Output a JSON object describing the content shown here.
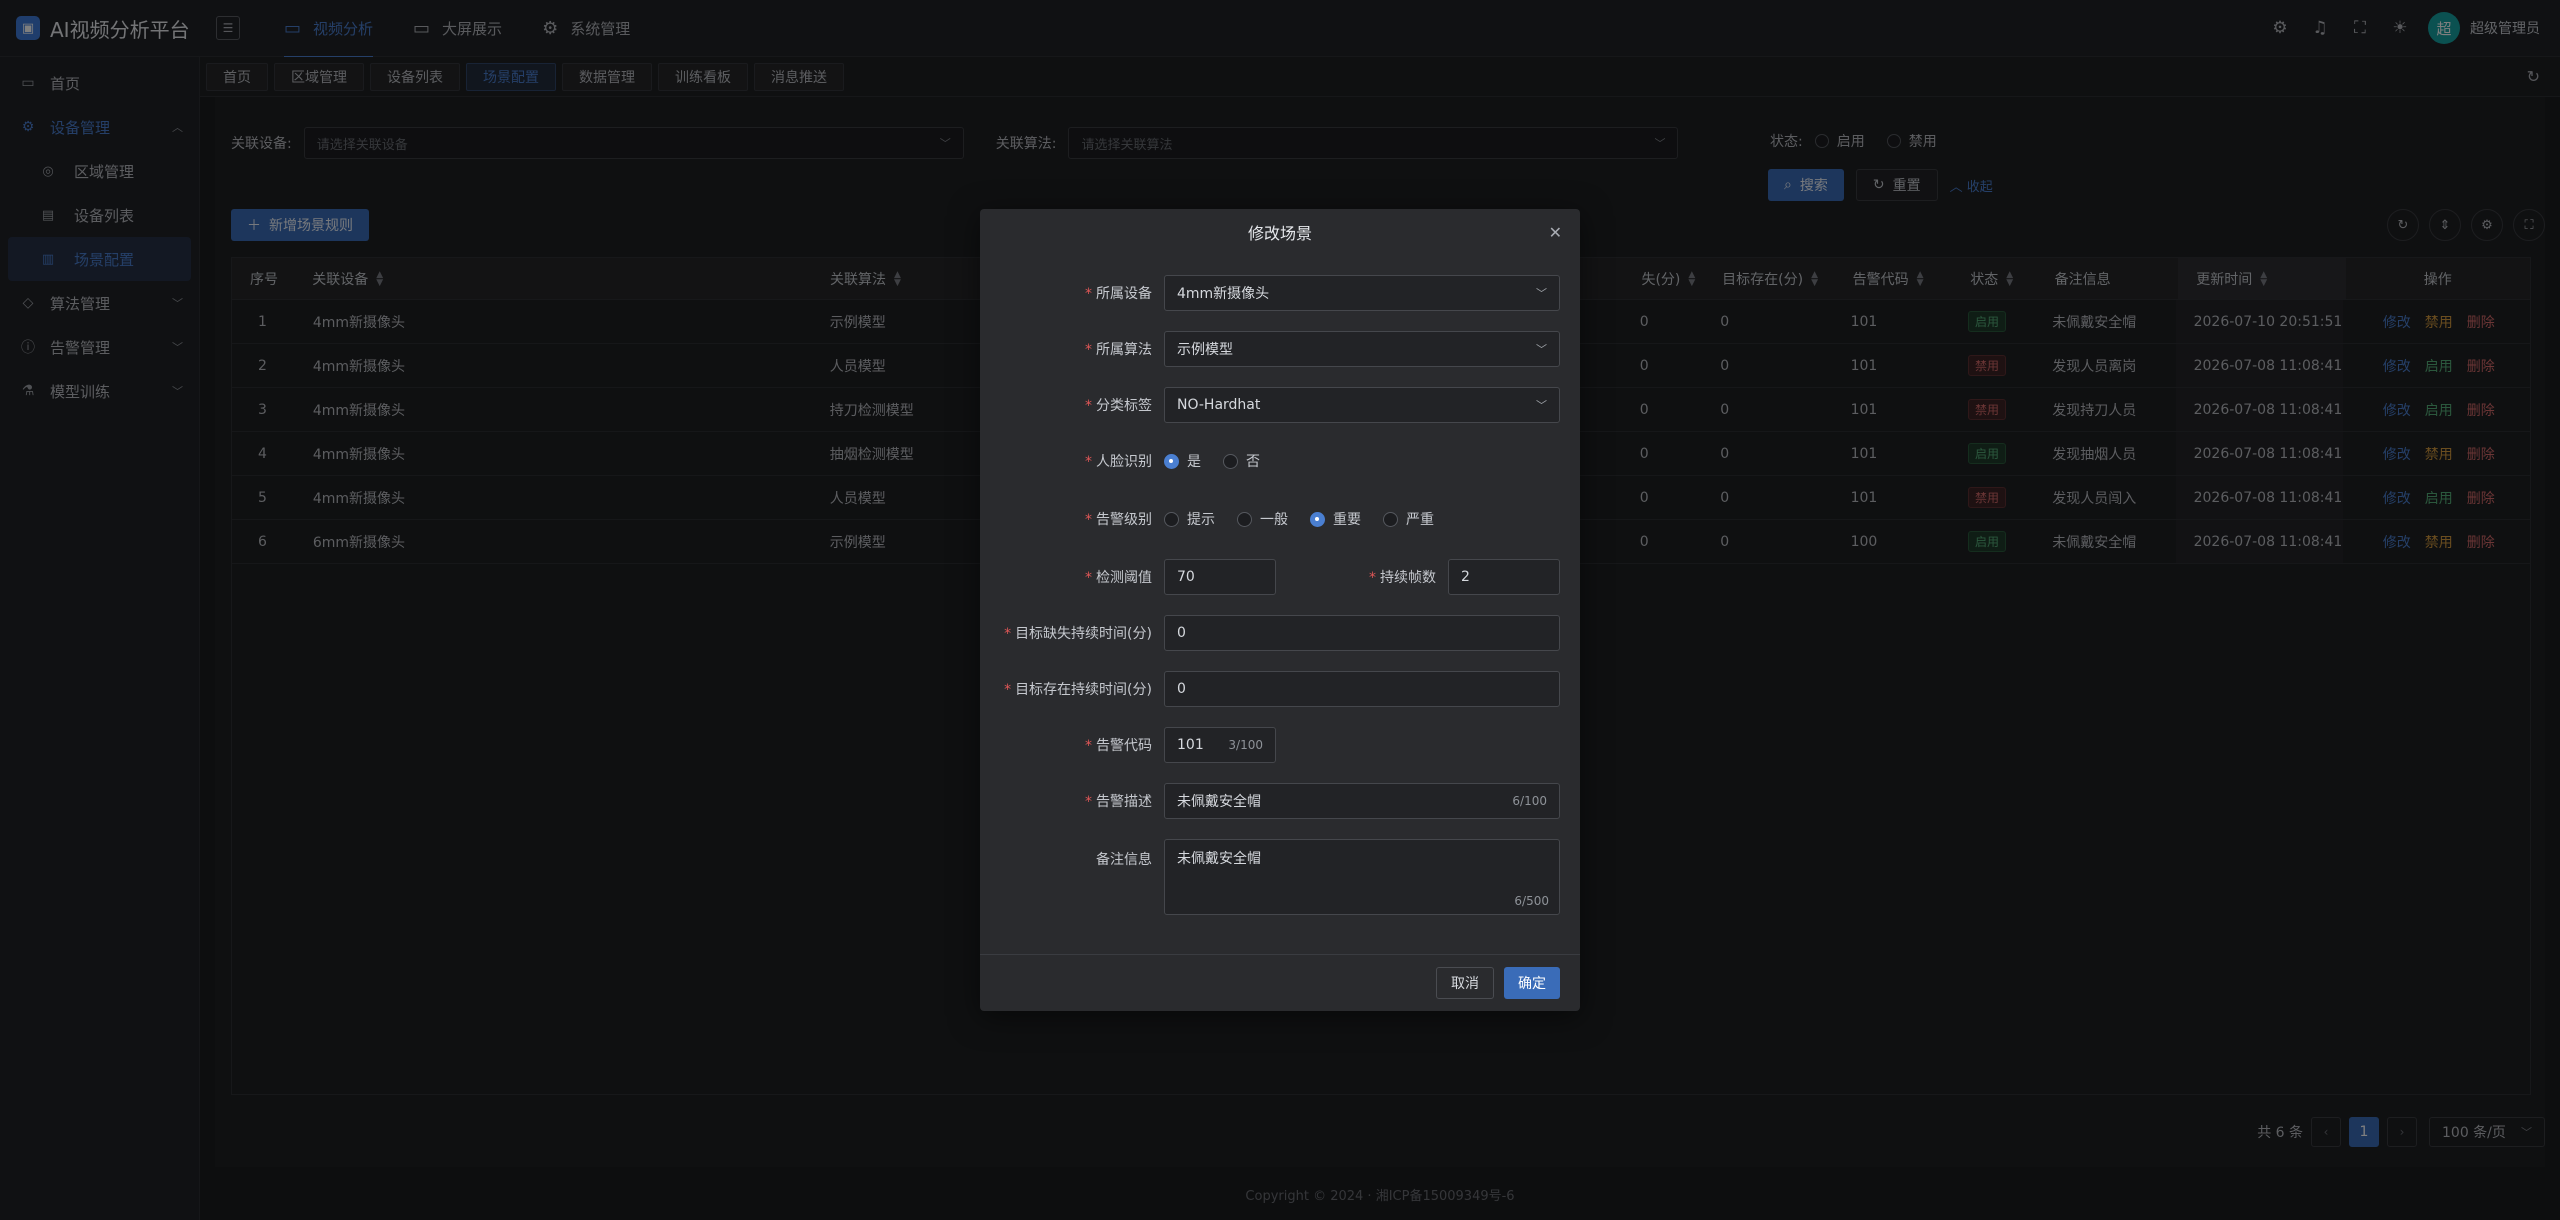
{
  "app": {
    "title": "AI视频分析平台",
    "logo_char": "▣"
  },
  "topnav": [
    {
      "label": "视频分析",
      "icon": "video-camera-icon",
      "glyph": "▭"
    },
    {
      "label": "大屏展示",
      "icon": "monitor-icon",
      "glyph": "▭"
    },
    {
      "label": "系统管理",
      "icon": "gear-icon",
      "glyph": "⚙"
    }
  ],
  "header_icons": [
    "settings-icon",
    "bell-icon",
    "fullscreen-icon",
    "theme-icon"
  ],
  "user": {
    "avatar_char": "超",
    "name": "超级管理员",
    "chevron": "⌄"
  },
  "sidebar": {
    "home": "首页",
    "device_mgmt": "设备管理",
    "sub": [
      "区域管理",
      "设备列表",
      "场景配置"
    ],
    "algo_mgmt": "算法管理",
    "alarm_mgmt": "告警管理",
    "model_train": "模型训练"
  },
  "tabs": [
    "首页",
    "区域管理",
    "设备列表",
    "场景配置",
    "数据管理",
    "训练看板",
    "消息推送"
  ],
  "filter": {
    "device_label": "关联设备:",
    "device_placeholder": "请选择关联设备",
    "algo_label": "关联算法:",
    "algo_placeholder": "请选择关联算法",
    "status_label": "状态:",
    "status_opts": [
      "启用",
      "禁用"
    ],
    "search_btn": "搜索",
    "reset_btn": "重置",
    "collapse_link": "收起"
  },
  "add_btn": "新增场景规则",
  "table": {
    "headers": [
      "序号",
      "关联设备",
      "关联算法",
      "失(分)",
      "目标存在(分)",
      "告警代码",
      "状态",
      "备注信息",
      "更新时间",
      "操作"
    ],
    "rows": [
      {
        "no": "1",
        "device": "4mm新摄像头",
        "algo": "示例模型",
        "lost": "0",
        "exist": "0",
        "code": "101",
        "status": "启用",
        "note": "未佩戴安全帽",
        "time": "2026-07-10 20:51:51",
        "ops": [
          "修改",
          "禁用",
          "删除"
        ]
      },
      {
        "no": "2",
        "device": "4mm新摄像头",
        "algo": "人员模型",
        "lost": "0",
        "exist": "0",
        "code": "101",
        "status": "禁用",
        "note": "发现人员离岗",
        "time": "2026-07-08 11:08:41",
        "ops": [
          "修改",
          "启用",
          "删除"
        ]
      },
      {
        "no": "3",
        "device": "4mm新摄像头",
        "algo": "持刀检测模型",
        "lost": "0",
        "exist": "0",
        "code": "101",
        "status": "禁用",
        "note": "发现持刀人员",
        "time": "2026-07-08 11:08:41",
        "ops": [
          "修改",
          "启用",
          "删除"
        ]
      },
      {
        "no": "4",
        "device": "4mm新摄像头",
        "algo": "抽烟检测模型",
        "lost": "0",
        "exist": "0",
        "code": "101",
        "status": "启用",
        "note": "发现抽烟人员",
        "time": "2026-07-08 11:08:41",
        "ops": [
          "修改",
          "禁用",
          "删除"
        ]
      },
      {
        "no": "5",
        "device": "4mm新摄像头",
        "algo": "人员模型",
        "lost": "0",
        "exist": "0",
        "code": "101",
        "status": "禁用",
        "note": "发现人员闯入",
        "time": "2026-07-08 11:08:41",
        "ops": [
          "修改",
          "启用",
          "删除"
        ]
      },
      {
        "no": "6",
        "device": "6mm新摄像头",
        "algo": "示例模型",
        "lost": "0",
        "exist": "0",
        "code": "100",
        "status": "启用",
        "note": "未佩戴安全帽",
        "time": "2026-07-08 11:08:41",
        "ops": [
          "修改",
          "禁用",
          "删除"
        ]
      }
    ]
  },
  "pager": {
    "total": "共 6 条",
    "current": "1",
    "size": "100 条/页"
  },
  "footer": "Copyright © 2024 · 湘ICP备15009349号-6",
  "dialog": {
    "title": "修改场景",
    "device_label": "所属设备",
    "device_value": "4mm新摄像头",
    "algo_label": "所属算法",
    "algo_value": "示例模型",
    "tag_label": "分类标签",
    "tag_value": "NO-Hardhat",
    "face_label": "人脸识别",
    "face_opts": [
      "是",
      "否"
    ],
    "level_label": "告警级别",
    "level_opts": [
      "提示",
      "一般",
      "重要",
      "严重"
    ],
    "threshold_label": "检测阈值",
    "threshold_value": "70",
    "frames_label": "持续帧数",
    "frames_value": "2",
    "lost_label": "目标缺失持续时间(分)",
    "lost_value": "0",
    "exist_label": "目标存在持续时间(分)",
    "exist_value": "0",
    "code_label": "告警代码",
    "code_value": "101",
    "code_count": "3/100",
    "desc_label": "告警描述",
    "desc_value": "未佩戴安全帽",
    "desc_count": "6/100",
    "note_label": "备注信息",
    "note_value": "未佩戴安全帽",
    "note_count": "6/500",
    "cancel": "取消",
    "ok": "确定"
  }
}
